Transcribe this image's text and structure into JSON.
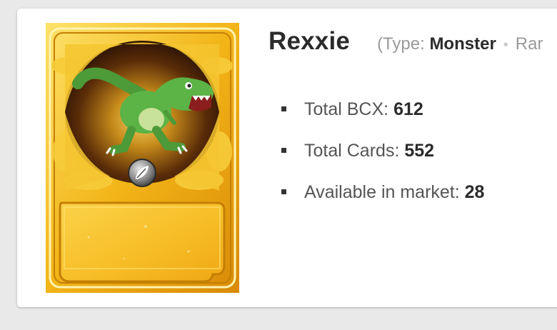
{
  "card": {
    "name": "Rexxie",
    "type_label": "(Type:",
    "type_value": "Monster",
    "rarity_label": "Rar"
  },
  "stats": [
    {
      "label": "Total BCX:",
      "value": "612"
    },
    {
      "label": "Total Cards:",
      "value": "552"
    },
    {
      "label": "Available in market:",
      "value": "28"
    }
  ],
  "colors": {
    "card_gold": "#f2b417",
    "card_frame": "#e89a0a",
    "dino_green": "#5cb346",
    "background": "#e9e9e9",
    "panel": "#ffffff"
  },
  "icons": {
    "element_icon": "neutral-leaf-icon"
  }
}
